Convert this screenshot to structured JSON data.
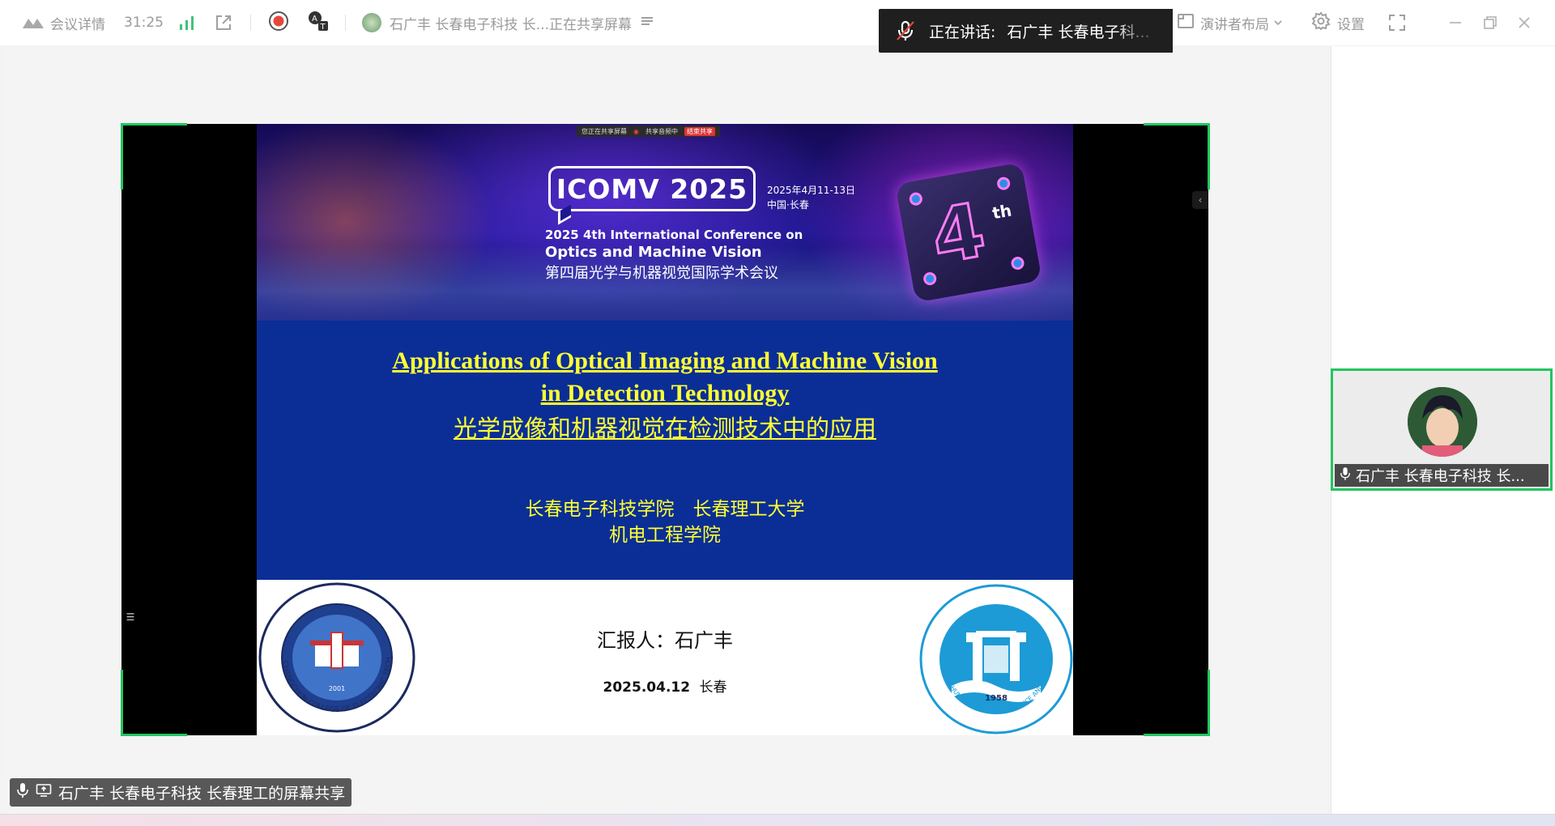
{
  "topbar": {
    "meeting_details": "会议详情",
    "timer": "31:25",
    "sharer_text": "石广丰 长春电子科技  长...正在共享屏幕",
    "speaking_label": "正在讲话:",
    "speaking_name": "石广丰 长春电子科...",
    "layout_label": "演讲者布局",
    "settings_label": "设置"
  },
  "slide": {
    "sharebar_status": "您正在共享屏幕",
    "sharebar_audio": "共享音频中",
    "sharebar_end": "结束共享",
    "logo_text": "ICOMV 2025",
    "conf_dates": "2025年4月11-13日",
    "conf_place": "中国·长春",
    "conf_en_line1": "2025 4th International Conference on",
    "conf_en_line2": "Optics and Machine Vision",
    "conf_cn": "第四届光学与机器视觉国际学术会议",
    "badge_num": "4",
    "badge_suffix": "th",
    "title_en_1": "Applications of Optical Imaging and Machine Vision",
    "title_en_2": "in Detection Technology",
    "title_cn": "光学成像和机器视觉在检测技术中的应用",
    "institution_1": "长春电子科技学院　长春理工大学",
    "institution_2": "机电工程学院",
    "presenter": "汇报人：石广丰",
    "date": "2025.04.12",
    "city": "长春",
    "seal_left_text": "CHANGCHUN COLLEGE OF ELECTRONIC TECHNOLOGY",
    "seal_left_year": "2001",
    "seal_right_text": "CHANGCHUN UNIVERSITY OF SCIENCE AND TECHNOLOGY",
    "seal_right_year": "1958"
  },
  "caption": {
    "text": "石广丰 长春电子科技  长春理工的屏幕共享"
  },
  "participant": {
    "name": "石广丰 长春电子科技  长..."
  },
  "colors": {
    "accent_green": "#22c55e",
    "slide_blue": "#0a2e96",
    "slide_yellow": "#ffff33"
  }
}
